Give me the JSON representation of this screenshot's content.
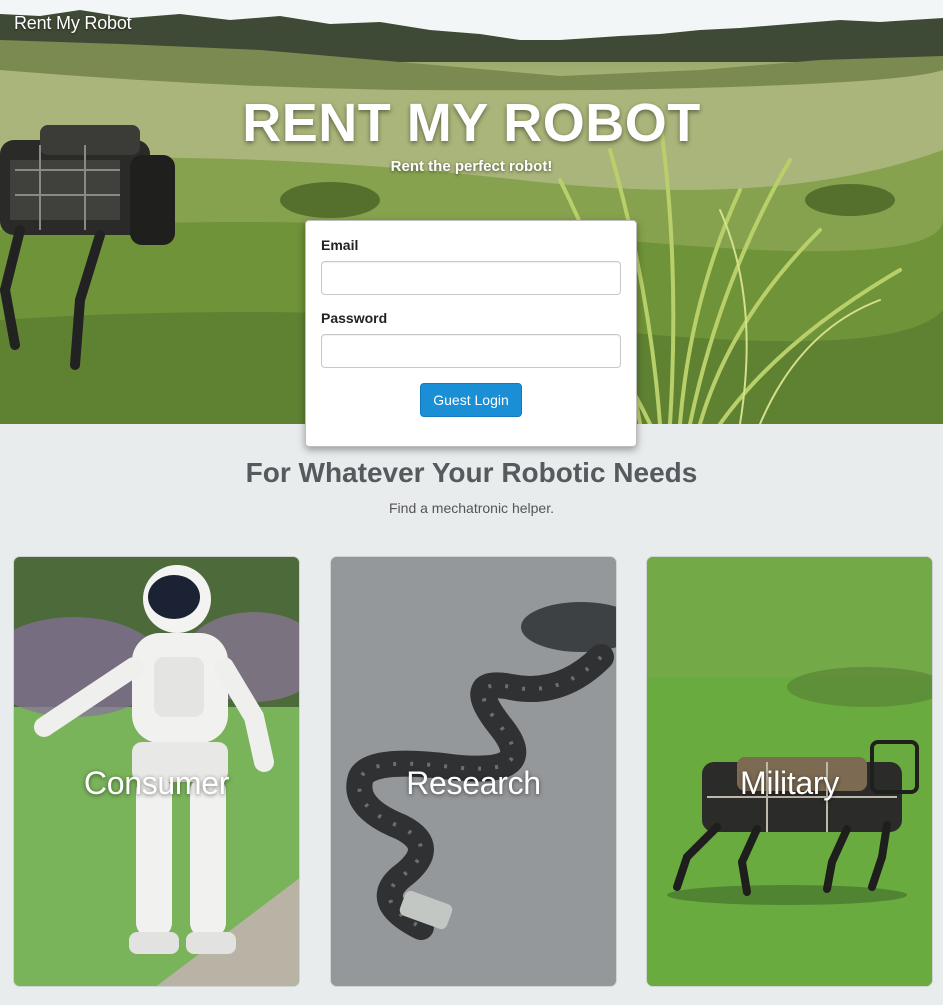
{
  "nav": {
    "brand": "Rent My Robot"
  },
  "hero": {
    "title": "RENT MY ROBOT",
    "subtitle": "Rent the perfect robot!"
  },
  "login": {
    "email_label": "Email",
    "email_value": "",
    "email_placeholder": "",
    "password_label": "Password",
    "password_value": "",
    "password_placeholder": "",
    "submit_label": "Guest Login",
    "button_color": "#1a8fd6"
  },
  "section": {
    "title": "For Whatever Your Robotic Needs",
    "subtitle": "Find a mechatronic helper."
  },
  "categories": [
    {
      "label": "Consumer",
      "image": "humanoid-robot"
    },
    {
      "label": "Research",
      "image": "snake-robot"
    },
    {
      "label": "Military",
      "image": "quadruped-robot"
    }
  ],
  "colors": {
    "page_background": "#e9ecec",
    "heading_text": "#555a5e"
  }
}
